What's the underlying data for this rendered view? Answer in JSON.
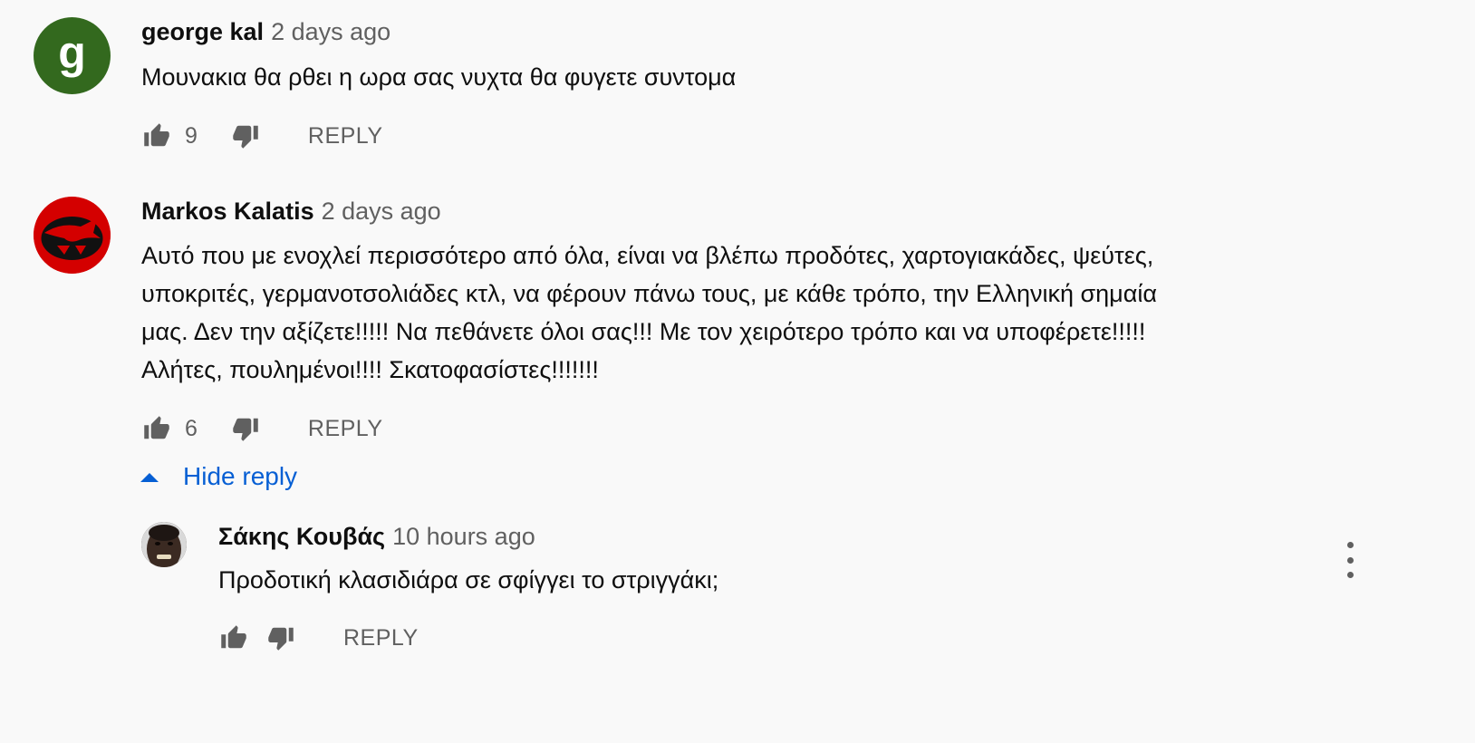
{
  "comments": [
    {
      "author": "george kal",
      "time": "2 days ago",
      "avatar_letter": "g",
      "avatar_color": "#33691e",
      "text_lines": [
        "Μουνακια θα ρθει η ωρα σας νυχτα θα φυγετε συντομα"
      ],
      "likes": "9",
      "reply_label": "REPLY"
    },
    {
      "author": "Markos Kalatis",
      "time": "2 days ago",
      "avatar_color": "#d40000",
      "text_lines": [
        "Αυτό που με ενοχλεί περισσότερο από όλα, είναι να βλέπω προδότες, χαρτογιακάδες, ψεύτες,",
        "υποκριτές, γερμανοτσολιάδες κτλ, να φέρουν πάνω τους, με κάθε τρόπο, την Ελληνική σημαία",
        "μας. Δεν την αξίζετε!!!!! Να πεθάνετε όλοι σας!!! Με τον χειρότερο τρόπο και να υποφέρετε!!!!!",
        "Αλήτες, πουλημένοι!!!! Σκατοφασίστες!!!!!!!"
      ],
      "likes": "6",
      "reply_label": "REPLY",
      "hide_replies_label": "Hide reply"
    }
  ],
  "reply": {
    "author": "Σάκης Κουβάς",
    "time": "10 hours ago",
    "text": "Προδοτική κλασιδιάρα σε σφίγγει το στριγγάκι;",
    "reply_label": "REPLY"
  },
  "colors": {
    "background": "#f9f9f9",
    "link": "#065fd4",
    "secondary_text": "#606060"
  }
}
